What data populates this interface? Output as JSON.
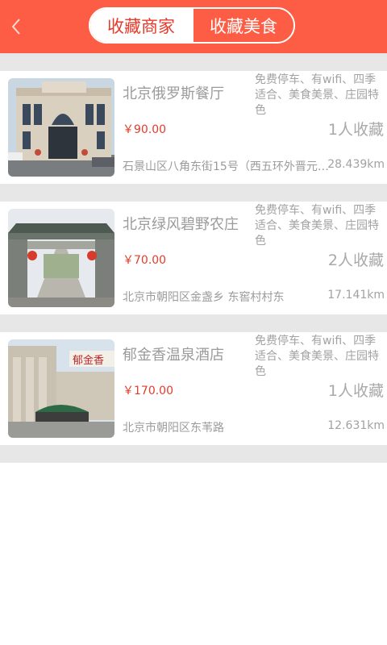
{
  "header": {
    "back_icon": "chevron-left-icon",
    "tabs": [
      {
        "label": "收藏商家",
        "active": true
      },
      {
        "label": "收藏美食",
        "active": false
      }
    ],
    "accent_color": "#fe5d45"
  },
  "items": [
    {
      "name": "北京俄罗斯餐厅",
      "tags": "免费停车、有wifi、四季适合、美食美景、庄园特色",
      "price": "￥90.00",
      "favorites": "1人收藏",
      "address": "石景山区八角东街15号（西五环外晋元桥西...",
      "distance": "28.439km"
    },
    {
      "name": "北京绿风碧野农庄",
      "tags": "免费停车、有wifi、四季适合、美食美景、庄园特色",
      "price": "￥70.00",
      "favorites": "2人收藏",
      "address": "北京市朝阳区金盏乡 东窖村村东",
      "distance": "17.141km"
    },
    {
      "name": "郁金香温泉酒店",
      "tags": "免费停车、有wifi、四季适合、美食美景、庄园特色",
      "price": "￥170.00",
      "favorites": "1人收藏",
      "address": "北京市朝阳区东苇路",
      "distance": "12.631km"
    }
  ]
}
